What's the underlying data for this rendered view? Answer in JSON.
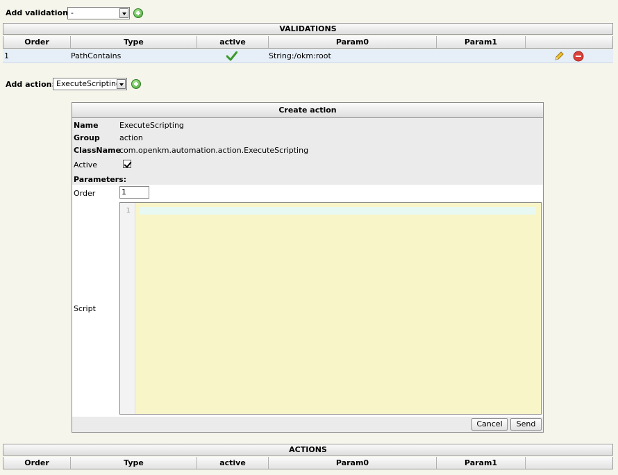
{
  "toolbar": {
    "add_validation_label": "Add validation:",
    "validation_select_value": "-",
    "add_action_label": "Add action:",
    "action_select_value": "ExecuteScripting"
  },
  "validations": {
    "title": "VALIDATIONS",
    "columns": [
      "Order",
      "Type",
      "active",
      "Param0",
      "Param1"
    ],
    "rows": [
      {
        "order": "1",
        "type": "PathContains",
        "active": true,
        "param0": "String:/okm:root",
        "param1": ""
      }
    ]
  },
  "create_action": {
    "title": "Create action",
    "name_label": "Name",
    "name_value": "ExecuteScripting",
    "group_label": "Group",
    "group_value": "action",
    "classname_label": "ClassName",
    "classname_value": "com.openkm.automation.action.ExecuteScripting",
    "active_label": "Active",
    "active_checked": true,
    "parameters_label": "Parameters:",
    "order_label": "Order",
    "order_value": "1",
    "script_label": "Script",
    "script_line_number": "1",
    "cancel_label": "Cancel",
    "send_label": "Send"
  },
  "actions": {
    "title": "ACTIONS",
    "columns": [
      "Order",
      "Type",
      "active",
      "Param0",
      "Param1"
    ]
  },
  "colors": {
    "page_bg": "#f5f5ec",
    "row_highlight": "#e6eef8",
    "editor_bg": "#f8f6c8",
    "add_icon": "#3f9e2c",
    "delete_icon": "#d9413a"
  }
}
